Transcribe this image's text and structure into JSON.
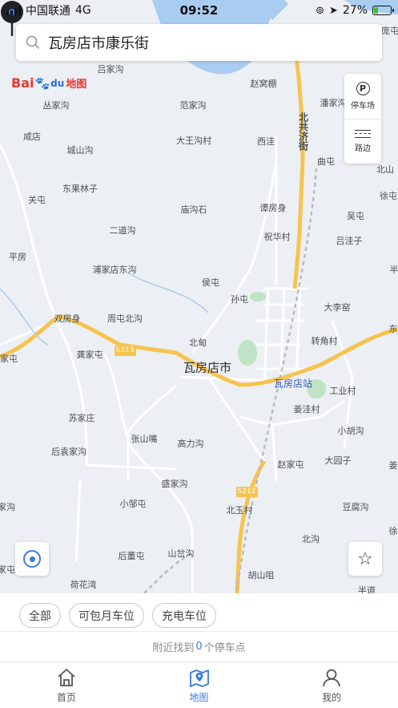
{
  "status_bar": {
    "carrier": "中国联通",
    "network": "4G",
    "time": "09:52",
    "battery_percent": "27%",
    "battery_level": 0.27
  },
  "search": {
    "value": "瓦房店市康乐街"
  },
  "brand": {
    "logo_text_bai": "Bai",
    "logo_text_du": "du",
    "logo_text_ditu": "地图"
  },
  "tools": {
    "parking_label": "停车场",
    "parking_glyph": "P",
    "roadside_label": "路边"
  },
  "map": {
    "labels": {
      "l01": "吕家沟",
      "l02": "丛家沟",
      "l03": "范家沟",
      "l04": "赵窝棚",
      "l05": "潘家沟",
      "l06": "咸店",
      "l07": "大王沟村",
      "l08": "西洼",
      "l09": "城山沟",
      "l10": "曲屯",
      "l11": "北山",
      "l12": "关屯",
      "l13": "东果林子",
      "l14": "谭房身",
      "l15": "徐屯",
      "l16": "庙沟石",
      "l17": "吴屯",
      "l18": "二道沟",
      "l19": "祝华村",
      "l20": "吕洼子",
      "l21": "平房",
      "l22": "浦家店东沟",
      "l23": "侯屯",
      "l24": "孙屯",
      "l25": "大李窑",
      "l26": "双房身",
      "l27": "周屯北沟",
      "l28": "转角村",
      "l29": "北甸",
      "l30": "家屯",
      "l31": "瓦房店市",
      "l32": "瓦房店站",
      "l33": "龚家屯",
      "l34": "工业村",
      "l35": "苏家庄",
      "l36": "姜洼村",
      "l37": "小胡沟",
      "l38": "后袁家沟",
      "l39": "张山嘴",
      "l40": "高力沟",
      "l41": "赵家屯",
      "l42": "大园子",
      "l43": "盛家沟",
      "l44": "小邹屯",
      "l45": "北玉村",
      "l46": "豆腐沟",
      "l47": "家沟",
      "l48": "北沟",
      "l49": "后董屯",
      "l50": "山岔沟",
      "l51": "荷花湾",
      "l52": "胡山咀",
      "l53": "半道",
      "l54": "庞屯",
      "l55": "北共济街",
      "l56": "S313",
      "l57": "S212",
      "l58": "半",
      "l59": "徐",
      "l60": "姜",
      "l61": "东",
      "l62": "家屯"
    }
  },
  "filters": {
    "all": "全部",
    "monthly": "可包月车位",
    "charging": "充电车位"
  },
  "result": {
    "prefix": "附近找到",
    "count": "0",
    "suffix": "个停车点"
  },
  "tabs": {
    "home": "首页",
    "map": "地图",
    "mine": "我的"
  },
  "colors": {
    "accent": "#3a7be0",
    "major_road": "#f6c44e",
    "water": "#a8cdf0",
    "green_area": "#bfe3c4"
  }
}
